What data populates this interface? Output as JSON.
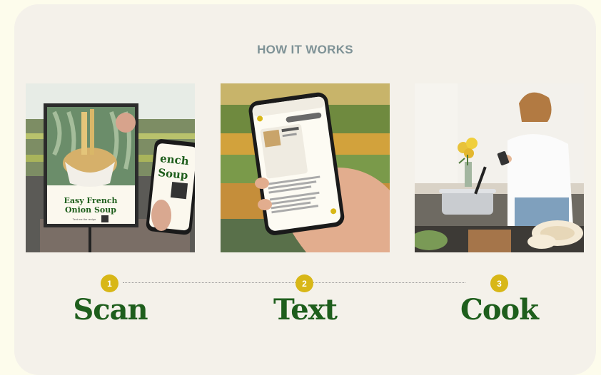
{
  "section": {
    "eyebrow": "HOW IT WORKS"
  },
  "steps": [
    {
      "number": "1",
      "label": "Scan",
      "image": {
        "poster_title_line1": "Easy French",
        "poster_title_line2": "Onion Soup",
        "poster_caption": "Text me the recipe",
        "phone_title_line1": "ench",
        "phone_title_line2": "Soup"
      }
    },
    {
      "number": "2",
      "label": "Text"
    },
    {
      "number": "3",
      "label": "Cook"
    }
  ],
  "colors": {
    "page_bg": "#fdfcec",
    "card_bg": "#f4f1ea",
    "eyebrow": "#7e9296",
    "badge": "#d8b717",
    "step_label": "#1e5e1c"
  }
}
